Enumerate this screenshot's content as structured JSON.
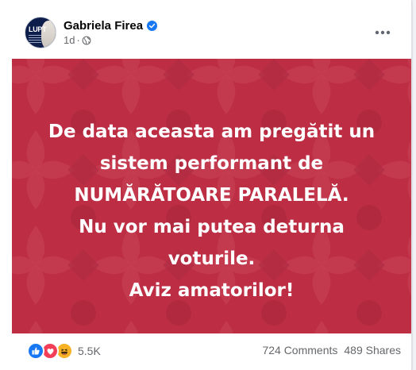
{
  "post": {
    "author": "Gabriela Firea",
    "timestamp": "1d",
    "separator": "·",
    "avatar_text": "LUPT",
    "privacy_icon": "globe-icon",
    "verified_icon": "verified-badge-icon",
    "more_icon": "more-options-icon"
  },
  "image": {
    "background_color": "#bd2e44",
    "lines": [
      "De data aceasta am pregătit un",
      "sistem performant de",
      "NUMĂRĂTOARE PARALELĂ.",
      "Nu vor mai putea deturna",
      "voturile.",
      "Aviz amatorilor!"
    ]
  },
  "engagement": {
    "reaction_icons": [
      "like-icon",
      "love-icon",
      "haha-icon"
    ],
    "reaction_count": "5.5K",
    "comments": "724 Comments",
    "shares": "489 Shares"
  },
  "colors": {
    "verified": "#1877f2",
    "like": "#1877f2",
    "love": "#f33e58",
    "haha": "#f7b125",
    "meta_text": "#65676b"
  }
}
